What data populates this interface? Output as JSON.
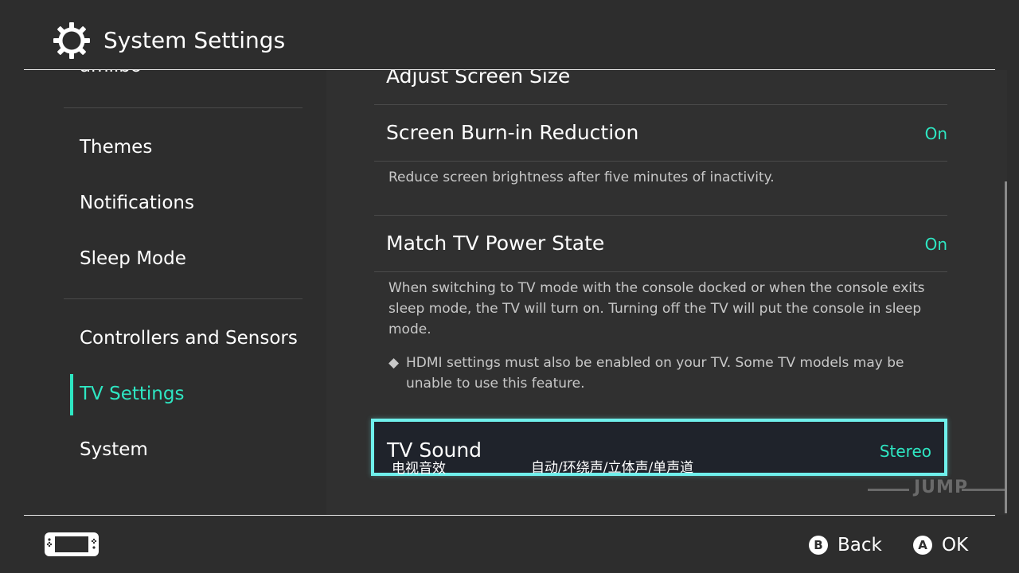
{
  "header": {
    "title": "System Settings"
  },
  "sidebar": {
    "items": [
      {
        "label": "amiibo"
      },
      {
        "label": "Themes"
      },
      {
        "label": "Notifications"
      },
      {
        "label": "Sleep Mode"
      },
      {
        "label": "Controllers and Sensors"
      },
      {
        "label": "TV Settings"
      },
      {
        "label": "System"
      }
    ],
    "active_index": 5
  },
  "content": {
    "adjust_screen_size": {
      "label": "Adjust Screen Size"
    },
    "burn_in": {
      "label": "Screen Burn-in Reduction",
      "value": "On",
      "description": "Reduce screen brightness after five minutes of inactivity."
    },
    "match_power": {
      "label": "Match TV Power State",
      "value": "On",
      "description": "When switching to TV mode with the console docked or when the console exits sleep mode, the TV will turn on. Turning off the TV will put the console in sleep mode.",
      "note": "HDMI settings must also be enabled on your TV. Some TV models may be unable to use this feature."
    },
    "tv_sound": {
      "label": "TV Sound",
      "value": "Stereo",
      "subtitle_label": "电视音效",
      "subtitle_options": "自动/环绕声/立体声/单声道"
    }
  },
  "watermark": "JUMP",
  "footer": {
    "back_label": "Back",
    "ok_label": "OK",
    "back_key": "B",
    "ok_key": "A"
  },
  "colors": {
    "background": "#2d2d2d",
    "accent": "#2ee6c2",
    "selection_border": "#6ff0ec"
  },
  "icons": [
    "gear-icon",
    "console-icon",
    "b-button-icon",
    "a-button-icon",
    "diamond-bullet-icon"
  ]
}
